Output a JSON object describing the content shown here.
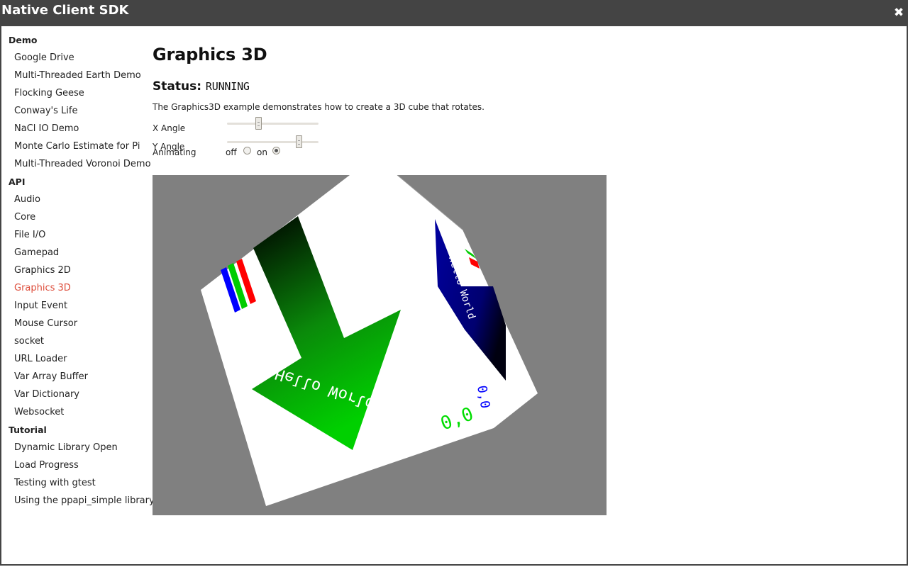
{
  "window": {
    "title": "Native Client SDK",
    "close_label": "✖"
  },
  "sidebar": {
    "sections": [
      {
        "title": "Demo",
        "items": [
          {
            "label": "Google Drive"
          },
          {
            "label": "Multi-Threaded Earth Demo"
          },
          {
            "label": "Flocking Geese"
          },
          {
            "label": "Conway's Life"
          },
          {
            "label": "NaCl IO Demo"
          },
          {
            "label": "Monte Carlo Estimate for Pi"
          },
          {
            "label": "Multi-Threaded Voronoi Demo"
          }
        ]
      },
      {
        "title": "API",
        "items": [
          {
            "label": "Audio"
          },
          {
            "label": "Core"
          },
          {
            "label": "File I/O"
          },
          {
            "label": "Gamepad"
          },
          {
            "label": "Graphics 2D"
          },
          {
            "label": "Graphics 3D",
            "active": true
          },
          {
            "label": "Input Event"
          },
          {
            "label": "Mouse Cursor"
          },
          {
            "label": "socket"
          },
          {
            "label": "URL Loader"
          },
          {
            "label": "Var Array Buffer"
          },
          {
            "label": "Var Dictionary"
          },
          {
            "label": "Websocket"
          }
        ]
      },
      {
        "title": "Tutorial",
        "items": [
          {
            "label": "Dynamic Library Open"
          },
          {
            "label": "Load Progress"
          },
          {
            "label": "Testing with gtest"
          },
          {
            "label": "Using the ppapi_simple library"
          }
        ]
      }
    ],
    "active_color": "#dd4b39"
  },
  "main": {
    "title": "Graphics 3D",
    "status_label": "Status:",
    "status_value": "RUNNING",
    "description": "The Graphics3D example demonstrates how to create a 3D cube that rotates.",
    "x_angle_label": "X Angle",
    "x_angle_value": 0.33,
    "y_angle_label": "Y Angle",
    "y_angle_value": 0.81,
    "animating_label": "Animating",
    "off_label": "off",
    "on_label": "on",
    "animating": "on",
    "cube_text": "Hello World",
    "cube_text_side": "Hello World",
    "cube_numbers": "0,0",
    "cube_numbers_side": "0,0",
    "canvas_bg": "#808080"
  }
}
